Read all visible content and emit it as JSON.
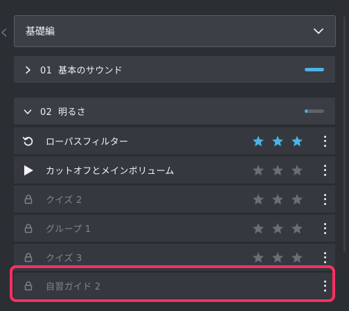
{
  "edge_glyph": "く",
  "dropdown": {
    "selected": "基礎編"
  },
  "sections": [
    {
      "number": "01",
      "title": "基本のサウンド",
      "expanded": false,
      "progress": 1.0
    },
    {
      "number": "02",
      "title": "明るさ",
      "expanded": true,
      "progress": 0.15
    }
  ],
  "items": [
    {
      "label": "ローパスフィルター",
      "icon": "replay-icon",
      "locked": false,
      "stars_filled": 3
    },
    {
      "label": "カットオフとメインボリューム",
      "icon": "play-icon",
      "locked": false,
      "stars_filled": 0
    },
    {
      "label": "クイズ 2",
      "icon": "lock-icon",
      "locked": true,
      "stars_filled": 0
    },
    {
      "label": "グループ 1",
      "icon": "lock-icon",
      "locked": true,
      "stars_filled": 0
    },
    {
      "label": "クイズ 3",
      "icon": "lock-icon",
      "locked": true,
      "stars_filled": 0
    },
    {
      "label": "自習ガイド 2",
      "icon": "lock-icon",
      "locked": true,
      "stars_filled": null
    }
  ],
  "colors": {
    "accent": "#4bb3e6",
    "star_empty": "#6a6f75",
    "highlight": "#ff2e63"
  }
}
